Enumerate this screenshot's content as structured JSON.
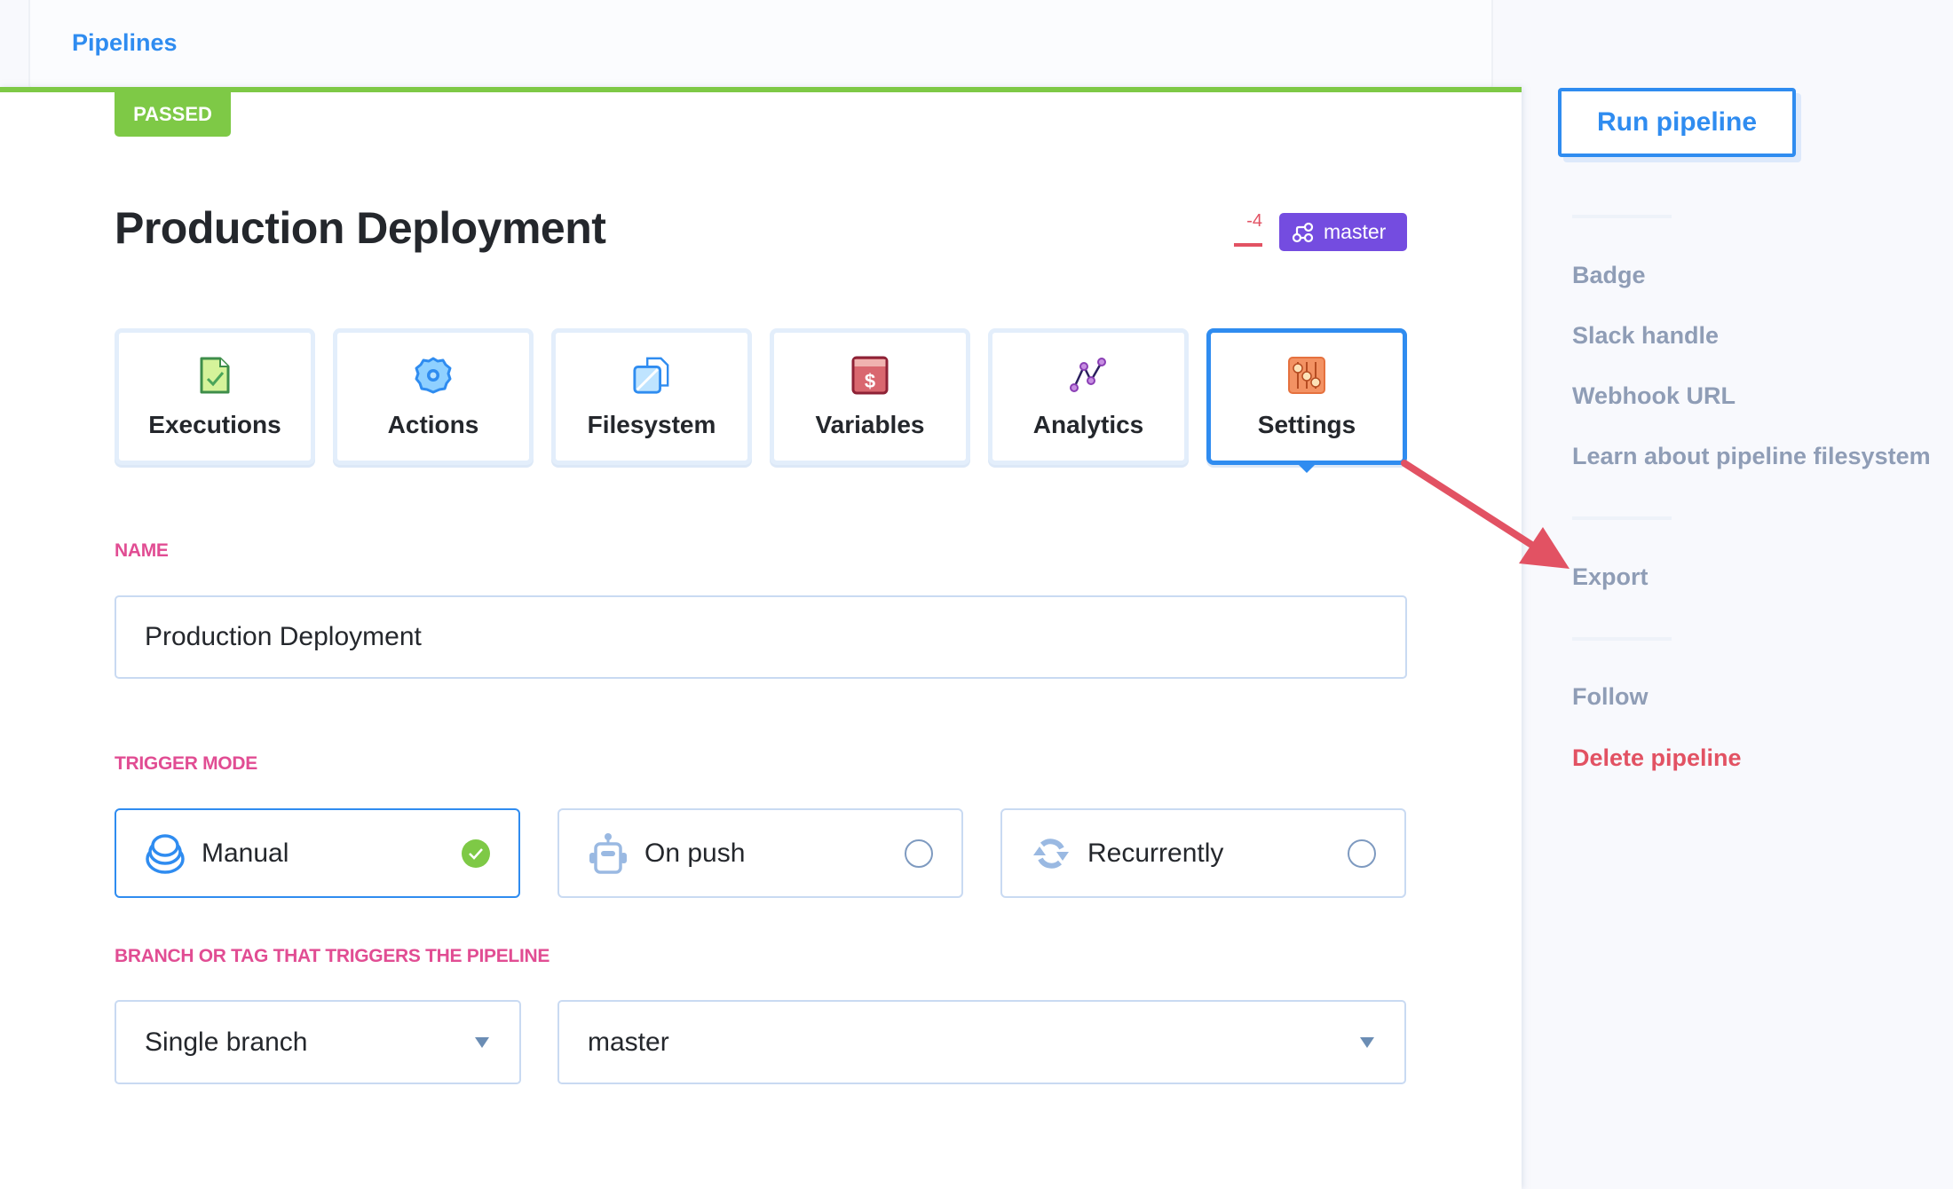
{
  "breadcrumb": {
    "label": "Pipelines"
  },
  "status": {
    "label": "PASSED",
    "color": "#7ec946"
  },
  "pipeline": {
    "title": "Production Deployment",
    "delta": "-4",
    "branch": "master"
  },
  "tabs": [
    {
      "label": "Executions",
      "icon": "file-check-icon",
      "active": false
    },
    {
      "label": "Actions",
      "icon": "gear-icon",
      "active": false
    },
    {
      "label": "Filesystem",
      "icon": "folder-file-icon",
      "active": false
    },
    {
      "label": "Variables",
      "icon": "dollar-card-icon",
      "active": false
    },
    {
      "label": "Analytics",
      "icon": "line-chart-icon",
      "active": false
    },
    {
      "label": "Settings",
      "icon": "sliders-icon",
      "active": true
    }
  ],
  "form": {
    "name_label": "NAME",
    "name_value": "Production Deployment",
    "trigger_label": "TRIGGER MODE",
    "trigger_modes": [
      {
        "label": "Manual",
        "icon": "stack-icon",
        "selected": true
      },
      {
        "label": "On push",
        "icon": "robot-icon",
        "selected": false
      },
      {
        "label": "Recurrently",
        "icon": "recurring-arrows-icon",
        "selected": false
      }
    ],
    "branch_label": "BRANCH OR TAG THAT TRIGGERS THE PIPELINE",
    "branch_type": "Single branch",
    "branch_value": "master"
  },
  "sidebar": {
    "run_button": "Run pipeline",
    "links_group1": [
      "Badge",
      "Slack handle",
      "Webhook URL",
      "Learn about pipeline filesystem"
    ],
    "export": "Export",
    "follow": "Follow",
    "delete": "Delete pipeline"
  },
  "colors": {
    "accent": "#2f8cf0",
    "success": "#7ec946",
    "danger": "#e25263",
    "label": "#e14d93",
    "branch_badge": "#744ce0"
  }
}
